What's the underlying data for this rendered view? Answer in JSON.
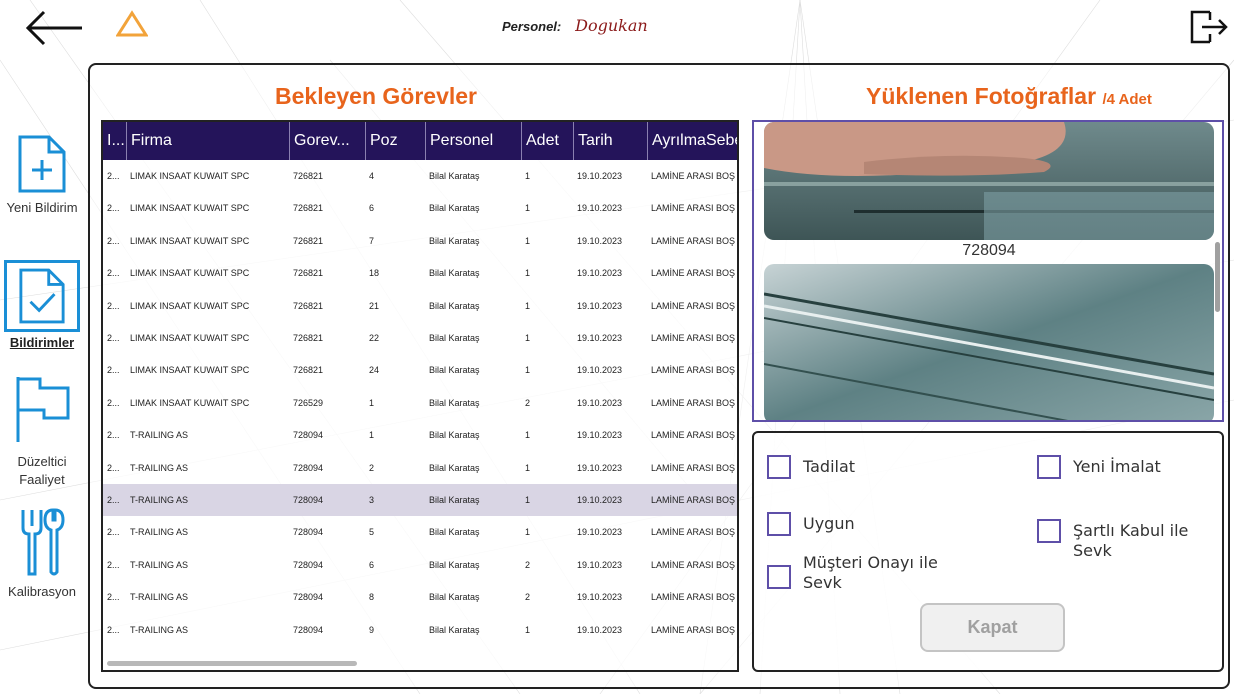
{
  "header": {
    "personel_label": "Personel:",
    "personel_value": "Dogukan"
  },
  "nav": {
    "items": [
      {
        "label": "Yeni Bildirim",
        "icon": "add-document-icon",
        "active": false
      },
      {
        "label": "Bildirimler",
        "icon": "checked-document-icon",
        "active": true
      },
      {
        "label": "Düzeltici Faaliyet",
        "icon": "flag-icon",
        "active": false
      },
      {
        "label": "Kalibrasyon",
        "icon": "tools-icon",
        "active": false
      }
    ]
  },
  "tasks": {
    "title": "Bekleyen Görevler",
    "columns": [
      "I...",
      "Firma",
      "Gorev...",
      "Poz",
      "Personel",
      "Adet",
      "Tarih",
      "AyrılmaSebe"
    ],
    "rows": [
      [
        "2...",
        "LIMAK INSAAT KUWAIT SPC",
        "726821",
        "4",
        "Bilal Karataş",
        "1",
        "19.10.2023",
        "LAMİNE ARASI BOŞ"
      ],
      [
        "2...",
        "LIMAK INSAAT KUWAIT SPC",
        "726821",
        "6",
        "Bilal Karataş",
        "1",
        "19.10.2023",
        "LAMİNE ARASI BOŞ"
      ],
      [
        "2...",
        "LIMAK INSAAT KUWAIT SPC",
        "726821",
        "7",
        "Bilal Karataş",
        "1",
        "19.10.2023",
        "LAMİNE ARASI BOŞ"
      ],
      [
        "2...",
        "LIMAK INSAAT KUWAIT SPC",
        "726821",
        "18",
        "Bilal Karataş",
        "1",
        "19.10.2023",
        "LAMİNE ARASI BOŞ"
      ],
      [
        "2...",
        "LIMAK INSAAT KUWAIT SPC",
        "726821",
        "21",
        "Bilal Karataş",
        "1",
        "19.10.2023",
        "LAMİNE ARASI BOŞ"
      ],
      [
        "2...",
        "LIMAK INSAAT KUWAIT SPC",
        "726821",
        "22",
        "Bilal Karataş",
        "1",
        "19.10.2023",
        "LAMİNE ARASI BOŞ"
      ],
      [
        "2...",
        "LIMAK INSAAT KUWAIT SPC",
        "726821",
        "24",
        "Bilal Karataş",
        "1",
        "19.10.2023",
        "LAMİNE ARASI BOŞ"
      ],
      [
        "2...",
        "LIMAK INSAAT KUWAIT SPC",
        "726529",
        "1",
        "Bilal Karataş",
        "2",
        "19.10.2023",
        "LAMİNE ARASI BOŞ"
      ],
      [
        "2...",
        "T-RAILING AS",
        "728094",
        "1",
        "Bilal Karataş",
        "1",
        "19.10.2023",
        "LAMİNE ARASI BOŞ"
      ],
      [
        "2...",
        "T-RAILING AS",
        "728094",
        "2",
        "Bilal Karataş",
        "1",
        "19.10.2023",
        "LAMİNE ARASI BOŞ"
      ],
      [
        "2...",
        "T-RAILING AS",
        "728094",
        "3",
        "Bilal Karataş",
        "1",
        "19.10.2023",
        "LAMİNE ARASI BOŞ"
      ],
      [
        "2...",
        "T-RAILING AS",
        "728094",
        "5",
        "Bilal Karataş",
        "1",
        "19.10.2023",
        "LAMİNE ARASI BOŞ"
      ],
      [
        "2...",
        "T-RAILING AS",
        "728094",
        "6",
        "Bilal Karataş",
        "2",
        "19.10.2023",
        "LAMİNE ARASI BOŞ"
      ],
      [
        "2...",
        "T-RAILING AS",
        "728094",
        "8",
        "Bilal Karataş",
        "2",
        "19.10.2023",
        "LAMİNE ARASI BOŞ"
      ],
      [
        "2...",
        "T-RAILING AS",
        "728094",
        "9",
        "Bilal Karataş",
        "1",
        "19.10.2023",
        "LAMİNE ARASI BOŞ"
      ]
    ],
    "selected_row": 10
  },
  "photos": {
    "title": "Yüklenen Fotoğraflar",
    "count_label": "/4 Adet",
    "captions": [
      "728094"
    ]
  },
  "options": {
    "items": [
      {
        "label": "Tadilat",
        "checked": false
      },
      {
        "label": "Yeni İmalat",
        "checked": false
      },
      {
        "label": "Uygun",
        "checked": false
      },
      {
        "label": "Şartlı Kabul ile Sevk",
        "checked": false
      },
      {
        "label": "Müşteri Onayı ile Sevk",
        "checked": false
      }
    ],
    "close_label": "Kapat"
  },
  "colors": {
    "accent_orange": "#e8641c",
    "header_purple": "#24145a",
    "nav_blue": "#1a8fd6",
    "checkbox_purple": "#5e4fa8",
    "personel_name": "#8b1a1a"
  }
}
